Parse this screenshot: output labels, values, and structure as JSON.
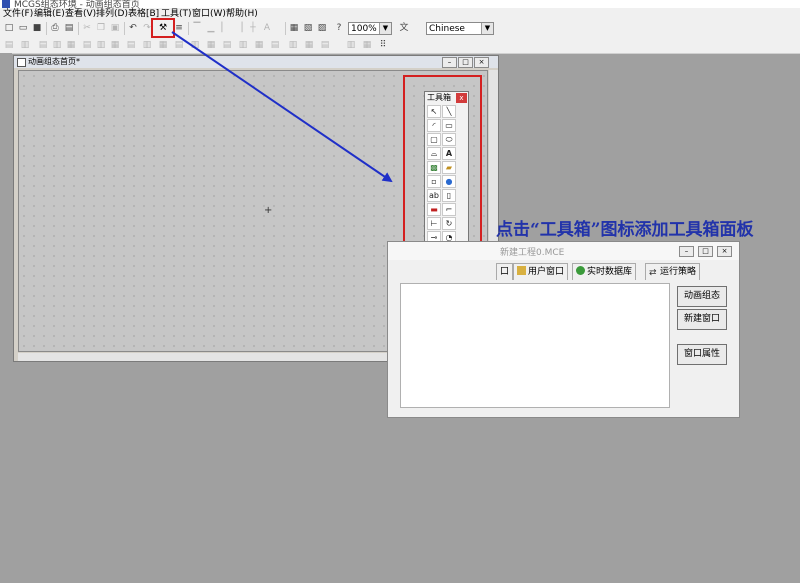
{
  "app": {
    "title": "MCGS组态环境 - 动画组态首页"
  },
  "menu": [
    "文件(F)",
    "编辑(E)",
    "查看(V)",
    "排列(D)",
    "表格[B]",
    "工具(T)",
    "窗口(W)",
    "帮助(H)"
  ],
  "toolbar": {
    "zoom": "100%",
    "language": "Chinese"
  },
  "editor": {
    "title": "动画组态首页*"
  },
  "toolbox": {
    "title": "工具箱",
    "close": "x",
    "tools": [
      "pointer-tool",
      "line-tool",
      "arc-tool",
      "rectangle-tool",
      "rounded-rect-tool",
      "ellipse-tool",
      "polygon-tool",
      "label-tool",
      "bitmap-tool",
      "picture-tool",
      "flow-tool",
      "library-tool",
      "input-box-tool",
      "io-tool",
      "button-tool",
      "line-segment-tool",
      "step-tool",
      "rotate-tool",
      "slider-tool",
      "gauge-tool",
      "composite-tool",
      "trend-tool",
      "curve-tool",
      "alarm-tool",
      "table-tool",
      "grid-tool",
      "report-tool",
      "bar-tool",
      "multi-tool",
      "list-tool",
      "image-tool"
    ]
  },
  "instruction": "点击“工具箱”图标添加工具箱面板",
  "workspace": {
    "title": "新建工程0.MCE",
    "tabs": [
      {
        "label": "口"
      },
      {
        "label": "用户窗口"
      },
      {
        "label": "实时数据库"
      },
      {
        "label": "运行策略"
      }
    ],
    "buttons": {
      "animation": "动画组态",
      "new_window": "新建窗口",
      "window_props": "窗口属性"
    }
  },
  "colors": {
    "highlight": "#d42020",
    "arrow": "#1f2fc8",
    "instruction": "#2233aa"
  }
}
